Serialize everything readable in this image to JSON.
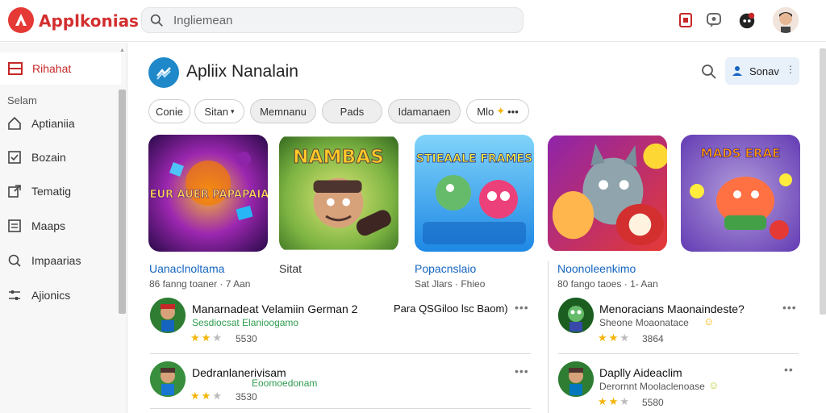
{
  "app": {
    "title": "Applkonias"
  },
  "search": {
    "placeholder": "Ingliemean"
  },
  "sidebar": {
    "active": {
      "label": "Rihahat"
    },
    "section": "Selam",
    "items": [
      {
        "label": "Aptianiia",
        "icon": "home-icon"
      },
      {
        "label": "Bozain",
        "icon": "check-square-icon"
      },
      {
        "label": "Tematig",
        "icon": "export-icon"
      },
      {
        "label": "Maaps",
        "icon": "list-icon"
      },
      {
        "label": "Impaarias",
        "icon": "search-icon"
      },
      {
        "label": "Ajionics",
        "icon": "settings-sliders-icon"
      }
    ]
  },
  "main": {
    "title": "Apliix Nanalain",
    "sort_label": "Sonav",
    "chips": [
      "Conie",
      "Sitan",
      "Memnanu",
      "Pads",
      "Idamanaen",
      "Mlo"
    ],
    "cards": [
      {
        "image_text": "FIEUR AUER PAPAPAIAN",
        "name": "Uanaclnoltama",
        "meta": "86  fanng  toaner · 7 Aan"
      },
      {
        "image_text": "NAMBAS",
        "name": "Sitat",
        "meta": ""
      },
      {
        "image_text": "STIEAALE FRAMES",
        "name": "Popacnslaio",
        "meta": "Sat  Jlars · Fhieo"
      },
      {
        "image_text": "",
        "name": "Noonoleenkimo",
        "meta": "80  fango  taoes · 1- Aan"
      },
      {
        "image_text": "MADS ERAE",
        "name": "",
        "meta": ""
      }
    ],
    "list_left": [
      {
        "title": "Manarnadeat Velamiin German 2",
        "extra": "Para QSGiloo lsc Baom)",
        "sub": "Sesdiocsat Elanioogamo",
        "count": "5530"
      },
      {
        "title": "Dedranlanerivisam",
        "extra": "",
        "sub": "Eoomoedonam",
        "count": "3530"
      }
    ],
    "list_right": [
      {
        "title": "Menoracians Maonaindeste?",
        "sub": "Sheone Moaonatace",
        "count": "3864"
      },
      {
        "title": "Daplly Aideaclim",
        "sub": "Derornnt Moolaclenoase",
        "count": "5580"
      }
    ]
  },
  "colors": {
    "brand": "#d32f2f",
    "accent": "#1e88c9",
    "link": "#1565c0",
    "subtitle": "#2e9d4f",
    "star": "#f4b400"
  }
}
